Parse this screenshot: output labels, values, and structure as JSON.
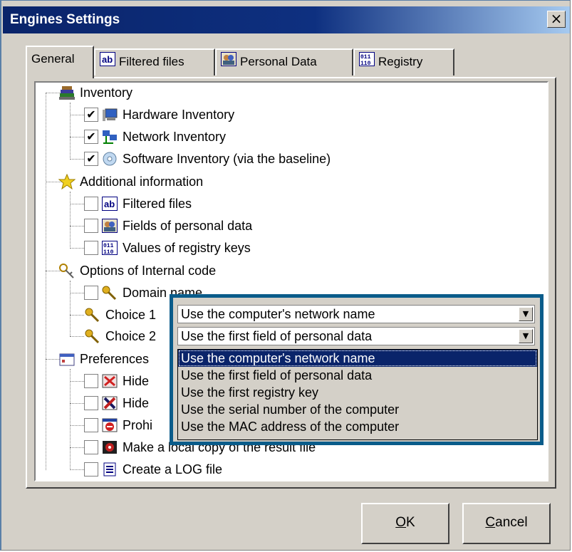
{
  "window": {
    "title": "Engines Settings",
    "close_glyph": "×"
  },
  "tabs": [
    {
      "label": "General",
      "icon": ""
    },
    {
      "label": "Filtered files",
      "icon": "ab-icon"
    },
    {
      "label": "Personal Data",
      "icon": "people-icon"
    },
    {
      "label": "Registry",
      "icon": "registry-icon"
    }
  ],
  "tree": {
    "inventory": "Inventory",
    "hardware": "Hardware Inventory",
    "network": "Network Inventory",
    "software": "Software Inventory (via the baseline)",
    "additional": "Additional information",
    "filtered": "Filtered files",
    "fields": "Fields of personal data",
    "values": "Values of registry keys",
    "options": "Options of Internal code",
    "domain": "Domain name",
    "choice1": "Choice 1",
    "choice2": "Choice 2",
    "preferences": "Preferences",
    "hide1": "Hide",
    "hide2": "Hide",
    "prohi": "Prohi",
    "make_local": "Make a local copy of the result file",
    "log": "Create a LOG file"
  },
  "combos": {
    "choice1_value": "Use the computer's network name",
    "choice2_value": "Use the first field of personal data"
  },
  "dropdown_options": [
    "Use the computer's network name",
    "Use the first field of personal data",
    "Use the first registry key",
    "Use the serial number of the computer",
    "Use the MAC address of the computer"
  ],
  "buttons": {
    "ok_prefix": "O",
    "ok_rest": "K",
    "cancel_prefix": "C",
    "cancel_rest": "ancel"
  },
  "colors": {
    "titlebar": "#0a246a",
    "highlight": "#0a5c8a"
  }
}
